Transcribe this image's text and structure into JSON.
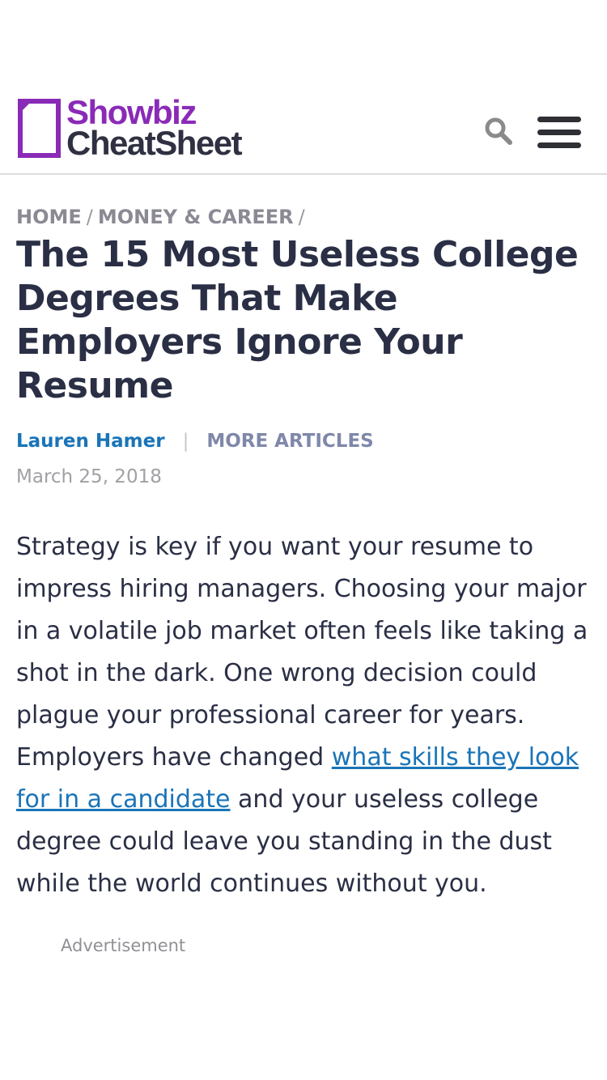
{
  "header": {
    "logo_line1": "Showbiz",
    "logo_line2": "CheatSheet",
    "brand_color": "#8a2bb7",
    "search_icon": "search-icon",
    "menu_icon": "hamburger-menu-icon"
  },
  "breadcrumb": {
    "home": "HOME",
    "category": "MONEY & CAREER",
    "separator": "/"
  },
  "article": {
    "title": "The 15 Most Useless College Degrees That Make Employers Ignore Your Resume",
    "author": "Lauren Hamer",
    "byline_separator": "|",
    "more_articles": "MORE ARTICLES",
    "date": "March 25, 2018",
    "body_before_link": "Strategy is key if you want your resume to impress hiring managers. Choosing your major in a volatile job market often feels like taking a shot in the dark. One wrong decision could plague your professional career for years. Employers have changed ",
    "body_link": "what skills they look for in a candidate",
    "body_after_link": " and your useless college degree could leave you standing in the dust while the world continues without you."
  },
  "ad": {
    "label": "Advertisement"
  },
  "colors": {
    "link": "#1a74b8",
    "text": "#2a2f45",
    "muted": "#8a8a94"
  }
}
